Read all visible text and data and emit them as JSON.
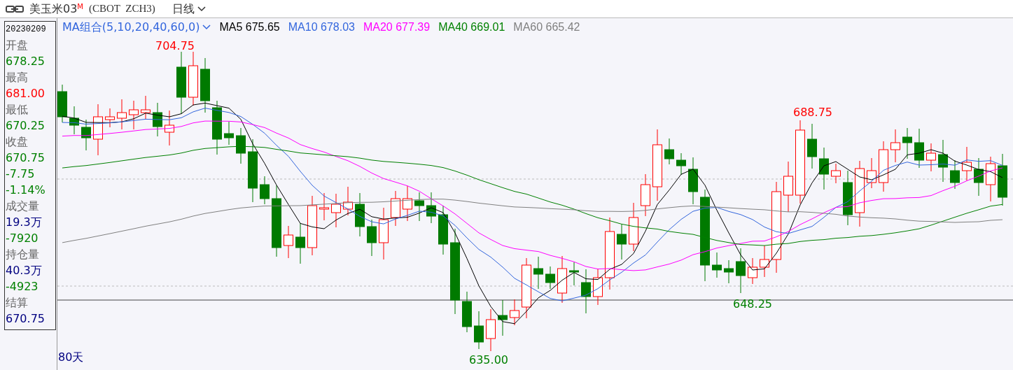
{
  "header": {
    "symbol": "美玉米03",
    "symbol_mark": "M",
    "code": "(CBOT  ZCH3)",
    "period": "日线"
  },
  "info_panel": {
    "date": "20230209",
    "items": [
      {
        "kind": "label",
        "text": "开盘"
      },
      {
        "kind": "value",
        "text": "678.25",
        "color": "#008000"
      },
      {
        "kind": "label",
        "text": "最高"
      },
      {
        "kind": "value",
        "text": "681.00",
        "color": "#ff0000"
      },
      {
        "kind": "label",
        "text": "最低"
      },
      {
        "kind": "value",
        "text": "670.25",
        "color": "#008000"
      },
      {
        "kind": "label",
        "text": "收盘"
      },
      {
        "kind": "value",
        "text": "670.75",
        "color": "#008000"
      },
      {
        "kind": "value",
        "text": "-7.75",
        "color": "#008000"
      },
      {
        "kind": "value",
        "text": "-1.14%",
        "color": "#008000"
      },
      {
        "kind": "label",
        "text": "成交量"
      },
      {
        "kind": "value",
        "text": "19.3万",
        "color": "#000080"
      },
      {
        "kind": "value",
        "text": "-7920",
        "color": "#008000"
      },
      {
        "kind": "label",
        "text": "持仓量"
      },
      {
        "kind": "value",
        "text": "40.3万",
        "color": "#000080"
      },
      {
        "kind": "value",
        "text": "-4923",
        "color": "#008000"
      },
      {
        "kind": "label",
        "text": "结算"
      },
      {
        "kind": "value",
        "text": "670.75",
        "color": "#000080"
      }
    ]
  },
  "legend": {
    "title": "MA组合(5,10,20,40,60,0)",
    "items": [
      {
        "name": "MA5",
        "value": "675.65",
        "color": "#000000"
      },
      {
        "name": "MA10",
        "value": "678.03",
        "color": "#3366dd"
      },
      {
        "name": "MA20",
        "value": "677.39",
        "color": "#ff00ff"
      },
      {
        "name": "MA40",
        "value": "669.01",
        "color": "#008000"
      },
      {
        "name": "MA60",
        "value": "665.42",
        "color": "#808080"
      }
    ]
  },
  "chart": {
    "labels": [
      {
        "text": "704.75",
        "kind": "high",
        "color": "#ff0000"
      },
      {
        "text": "688.75",
        "kind": "high",
        "color": "#ff0000"
      },
      {
        "text": "648.25",
        "kind": "low",
        "color": "#008000"
      },
      {
        "text": "635.00",
        "kind": "low",
        "color": "#008000"
      }
    ]
  },
  "footer": {
    "range": "80天"
  }
}
